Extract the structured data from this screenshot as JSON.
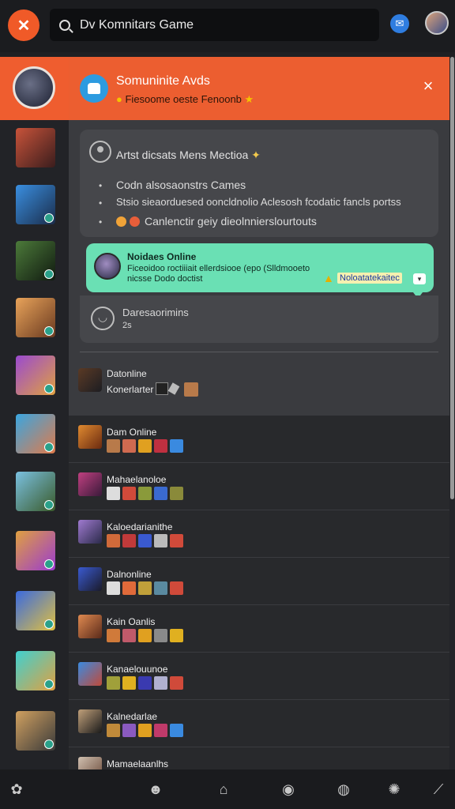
{
  "topbar": {
    "search_value": "Dv Komnitars Game"
  },
  "header": {
    "title": "Somuninite Avds",
    "subtitle": "Fiesoome oeste Fenoonb"
  },
  "card": {
    "line1": "Artst dicsats Mens Mectioa",
    "item1": "Codn alsosaonstrs Cames",
    "item2": "Stsio sieaorduesed ooncldnolio Aclesosh fcodatic fancls portss",
    "item3": "Canlenctir geiy dieolnnierslourtouts"
  },
  "notice": {
    "title": "Noidaes Online",
    "body": "Ficeoidoo roctiiiait ellerdsiooe (epo (Slldmooeto nicsse Dodo doctist",
    "tag": "Noloatatekaitec"
  },
  "status": {
    "title": "Daresaorimins",
    "sub": "2s"
  },
  "inrow": {
    "title": "Datonline",
    "sub": "Konerlarter"
  },
  "games": [
    {
      "name": "Dam Online"
    },
    {
      "name": "Mahaelanoloe"
    },
    {
      "name": "Kaloedarianithe"
    },
    {
      "name": "Dalnonline"
    },
    {
      "name": "Kain Oanlis"
    },
    {
      "name": "Kanaelouunoe"
    },
    {
      "name": "Kalnedarlae"
    },
    {
      "name": "Mamaelaanlhs"
    }
  ],
  "colors": {
    "brand": "#ef5d2f",
    "notice": "#6ae0b4",
    "online_dot": "#2aa18a"
  },
  "icons": {
    "logo": "fox-logo-icon",
    "search": "search-icon",
    "messages": "message-icon",
    "close": "close-icon",
    "nav": [
      "home-icon",
      "profile-icon",
      "store-icon",
      "controller-icon",
      "chat-icon",
      "settings-icon",
      "tools-icon"
    ]
  }
}
